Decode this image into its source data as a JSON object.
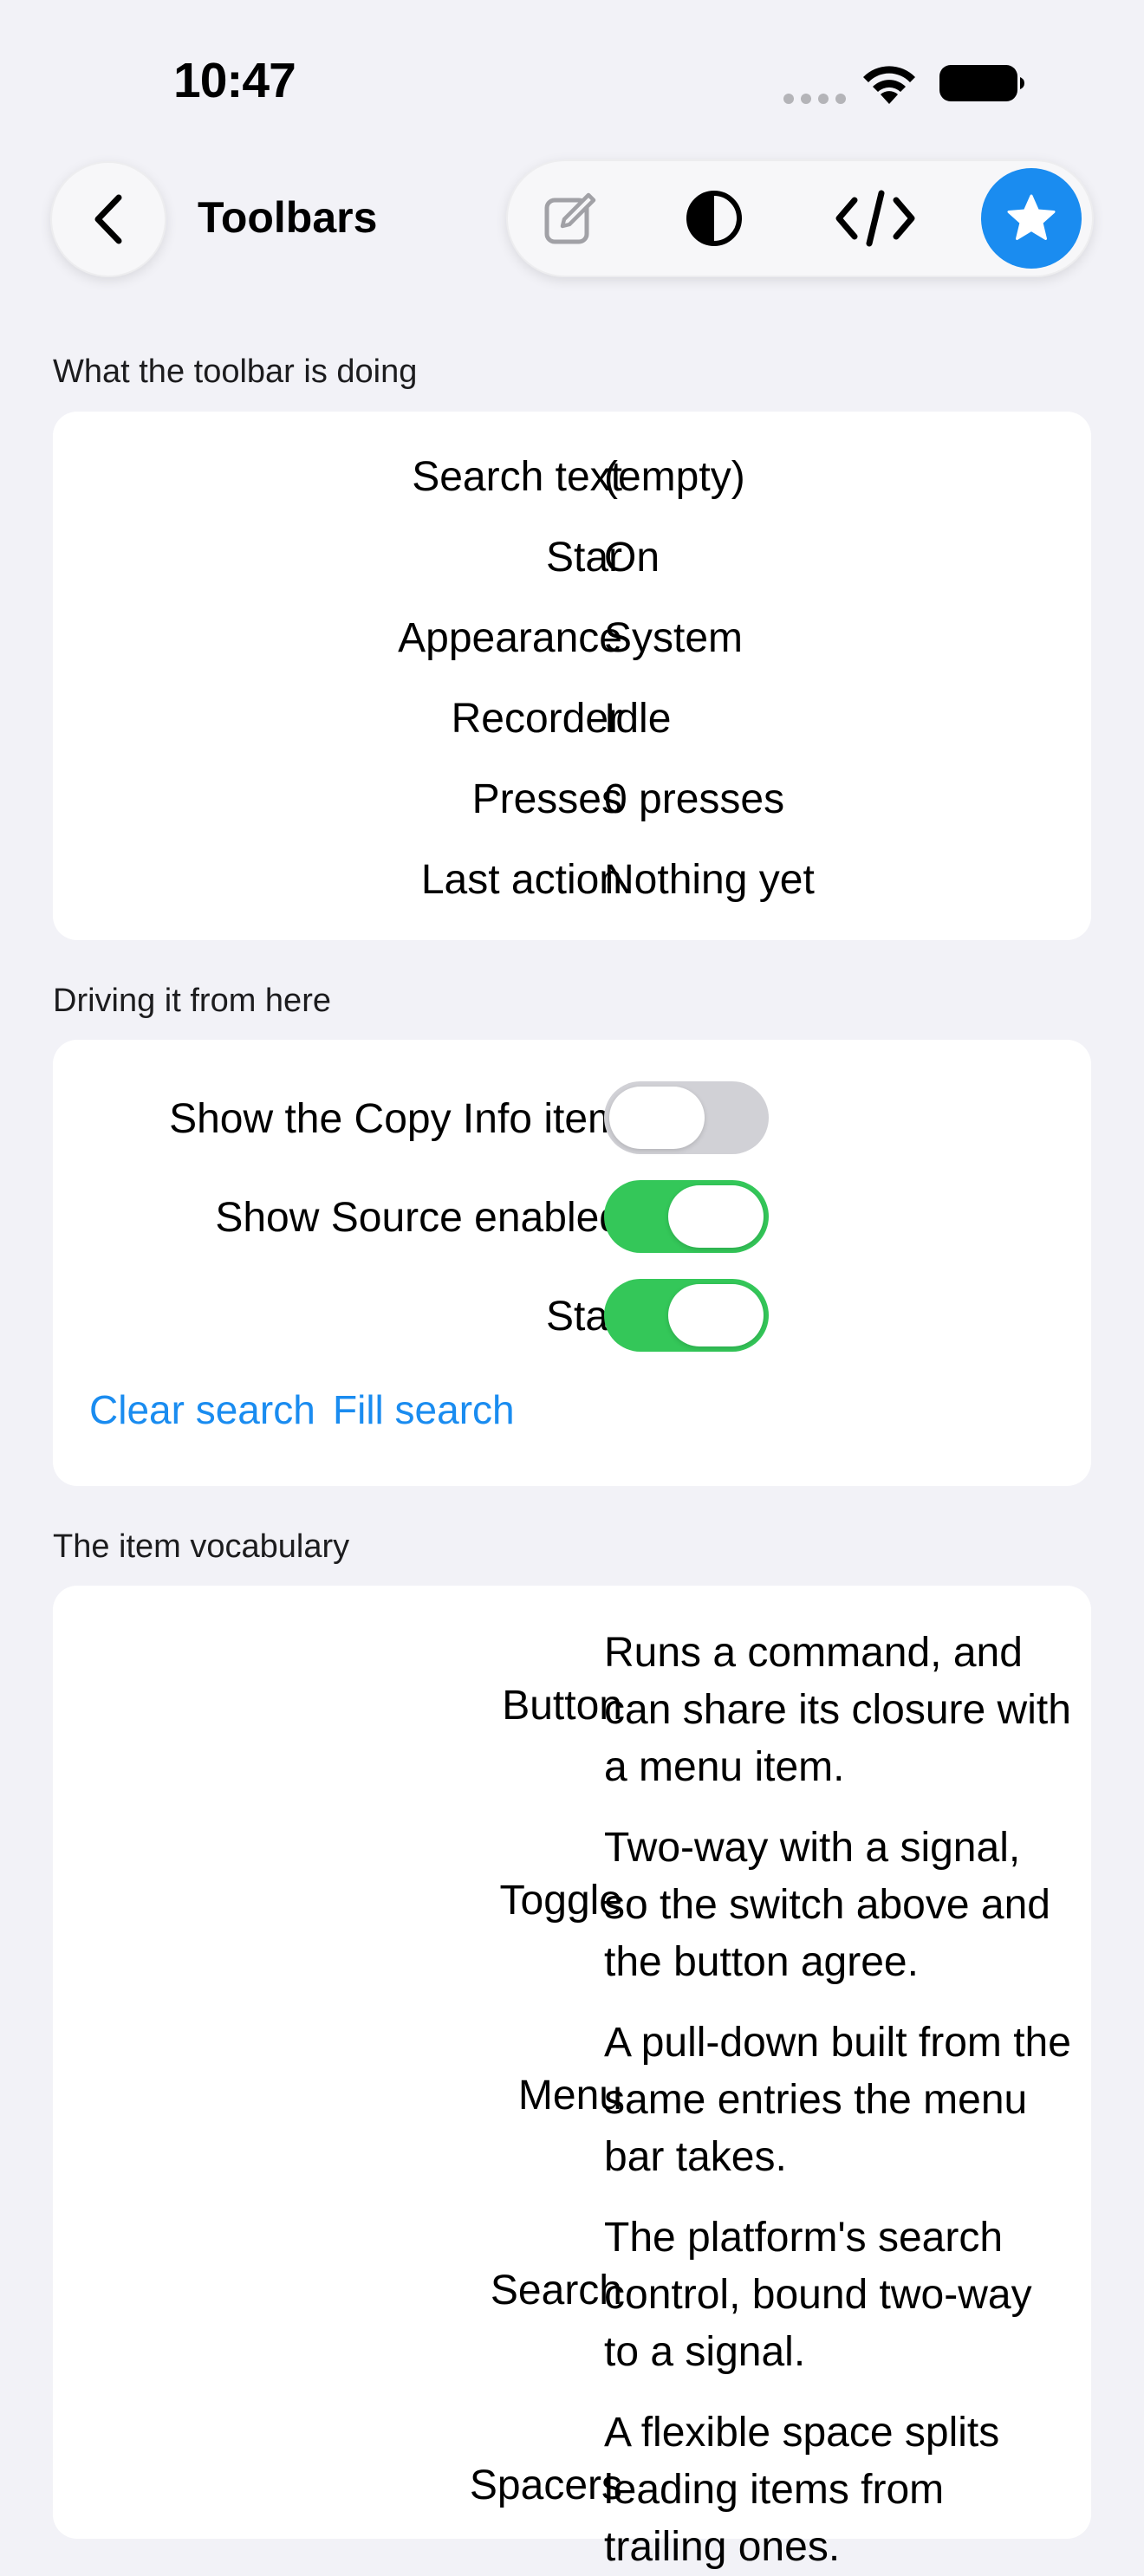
{
  "status_bar": {
    "time": "10:47"
  },
  "nav": {
    "title": "Toolbars"
  },
  "toolbar": {
    "icons": [
      "edit-icon",
      "contrast-icon",
      "code-icon",
      "star-icon"
    ],
    "accent_color": "#1a8cf0"
  },
  "status_section": {
    "header": "What the toolbar is doing",
    "rows": [
      {
        "key": "Search text",
        "value": "(empty)"
      },
      {
        "key": "Star",
        "value": "On"
      },
      {
        "key": "Appearance",
        "value": "System"
      },
      {
        "key": "Recorder",
        "value": "Idle"
      },
      {
        "key": "Presses",
        "value": "0 presses"
      },
      {
        "key": "Last action",
        "value": "Nothing yet"
      }
    ]
  },
  "controls_section": {
    "header": "Driving it from here",
    "toggles": [
      {
        "label": "Show the Copy Info item",
        "on": false
      },
      {
        "label": "Show Source enabled",
        "on": true
      },
      {
        "label": "Star",
        "on": true
      }
    ],
    "links": [
      "Clear search",
      "Fill search"
    ],
    "toggle_on_color": "#34c759"
  },
  "vocab_section": {
    "header": "The item vocabulary",
    "items": [
      {
        "term": "Button",
        "desc": "Runs a command, and can share its closure with a menu item."
      },
      {
        "term": "Toggle",
        "desc": "Two-way with a signal, so the switch above and the button agree."
      },
      {
        "term": "Menu",
        "desc": "A pull-down built from the same entries the menu bar takes."
      },
      {
        "term": "Search",
        "desc": "The platform's search control, bound two-way to a signal."
      },
      {
        "term": "Spacers",
        "desc": "A flexible space splits leading items from trailing ones."
      }
    ]
  }
}
